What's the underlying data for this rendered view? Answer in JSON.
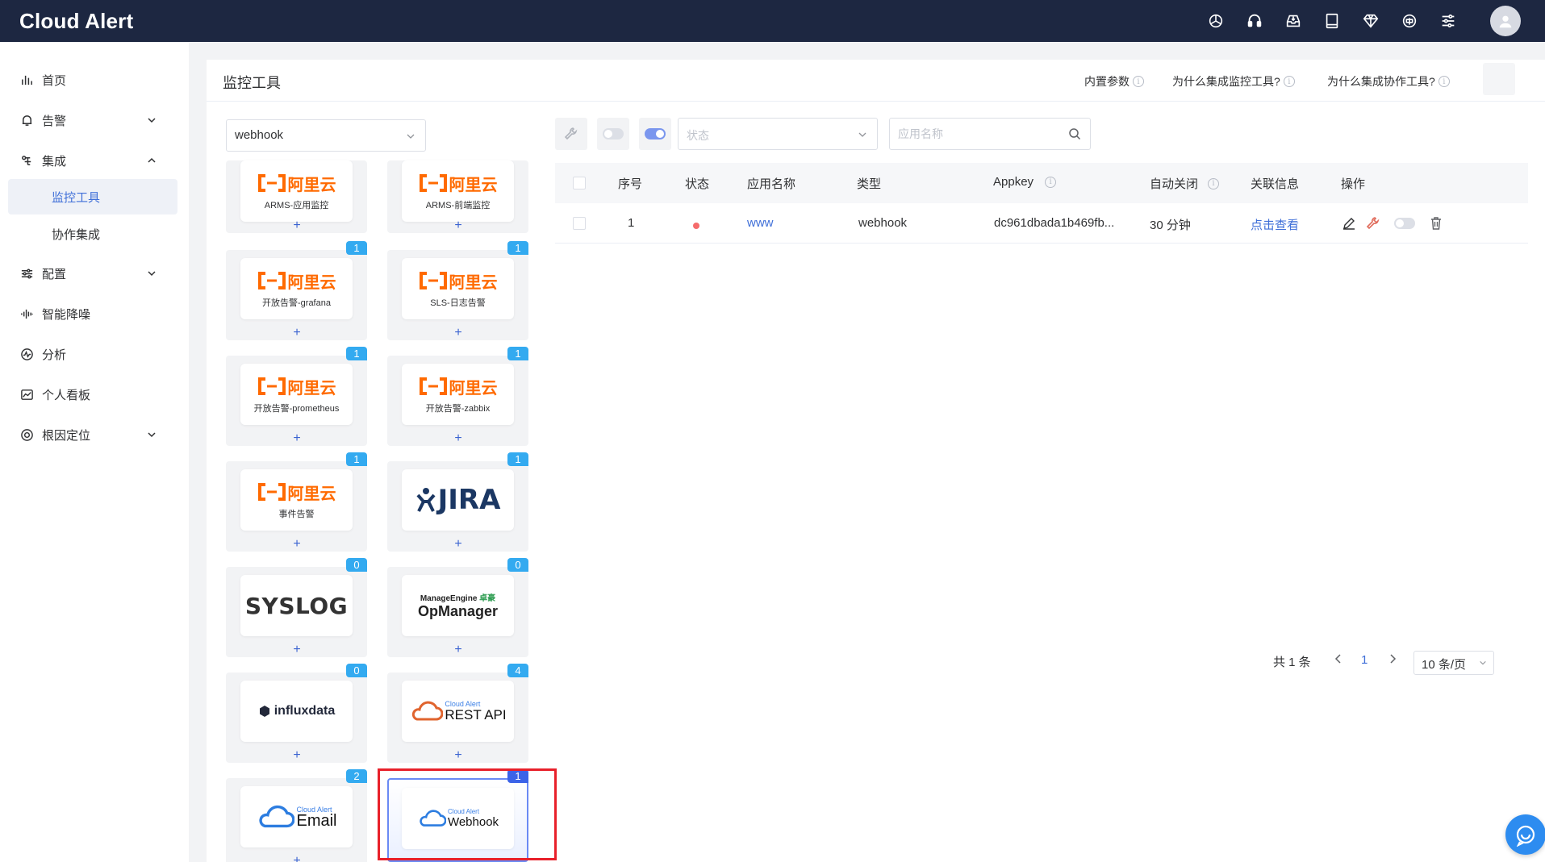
{
  "app": {
    "title": "Cloud Alert"
  },
  "topbar": {
    "icons": [
      "openai-icon",
      "headset-icon",
      "inbox-icon",
      "book-icon",
      "diamond-icon",
      "language-icon",
      "settings-sliders-icon"
    ],
    "avatar": "user-avatar"
  },
  "sidebar": {
    "items": [
      {
        "label": "首页",
        "icon": "bar-chart-icon"
      },
      {
        "label": "告警",
        "icon": "bell-icon",
        "expandable": true,
        "expanded": false
      },
      {
        "label": "集成",
        "icon": "integration-icon",
        "expandable": true,
        "expanded": true
      },
      {
        "label": "配置",
        "icon": "sliders-icon",
        "expandable": true,
        "expanded": false
      },
      {
        "label": "智能降噪",
        "icon": "waveform-icon"
      },
      {
        "label": "分析",
        "icon": "gauge-icon"
      },
      {
        "label": "个人看板",
        "icon": "dashboard-icon"
      },
      {
        "label": "根因定位",
        "icon": "target-icon",
        "expandable": true,
        "expanded": false
      }
    ],
    "subitems": [
      {
        "label": "监控工具",
        "active": true
      },
      {
        "label": "协作集成",
        "active": false
      }
    ]
  },
  "header": {
    "title": "监控工具",
    "links": [
      "内置参数",
      "为什么集成监控工具?",
      "为什么集成协作工具?"
    ]
  },
  "filter": {
    "type_value": "webhook"
  },
  "cards": [
    {
      "kind": "aliyun",
      "brand": "阿里云",
      "name": "ARMS-应用监控",
      "badge": null
    },
    {
      "kind": "aliyun",
      "brand": "阿里云",
      "name": "ARMS-前端监控",
      "badge": null
    },
    {
      "kind": "aliyun",
      "brand": "阿里云",
      "name": "开放告警-grafana",
      "badge": "1"
    },
    {
      "kind": "aliyun",
      "brand": "阿里云",
      "name": "SLS-日志告警",
      "badge": "1"
    },
    {
      "kind": "aliyun",
      "brand": "阿里云",
      "name": "开放告警-prometheus",
      "badge": "1"
    },
    {
      "kind": "aliyun",
      "brand": "阿里云",
      "name": "开放告警-zabbix",
      "badge": "1"
    },
    {
      "kind": "aliyun",
      "brand": "阿里云",
      "name": "事件告警",
      "badge": "1"
    },
    {
      "kind": "jira",
      "brand": "JIRA",
      "name": "",
      "badge": "1"
    },
    {
      "kind": "syslog",
      "brand": "SYSLOG",
      "name": "",
      "badge": "0"
    },
    {
      "kind": "manageengine",
      "brand": "ManageEngine",
      "brand_cn": "卓豪",
      "name": "OpManager",
      "badge": "0"
    },
    {
      "kind": "influx",
      "brand": "influxdata",
      "name": "",
      "badge": "0"
    },
    {
      "kind": "cloudalert",
      "brand": "Cloud Alert",
      "name": "REST API",
      "badge": "4"
    },
    {
      "kind": "cloudalert",
      "brand": "Cloud Alert",
      "name": "Email",
      "badge": "2"
    },
    {
      "kind": "cloudalert",
      "brand": "Cloud Alert",
      "name": "Webhook",
      "badge": "1",
      "selected": true
    }
  ],
  "toolbar": {
    "status_placeholder": "状态",
    "name_placeholder": "应用名称"
  },
  "table": {
    "headers": {
      "index": "序号",
      "status": "状态",
      "app_name": "应用名称",
      "type": "类型",
      "appkey": "Appkey",
      "auto_close": "自动关闭",
      "related": "关联信息",
      "actions": "操作"
    },
    "rows": [
      {
        "index": "1",
        "status": "red",
        "app_name": "www",
        "type": "webhook",
        "appkey": "dc961dbada1b469fb...",
        "auto_close": "30 分钟",
        "related": "点击查看"
      }
    ]
  },
  "pagination": {
    "total": "共 1 条",
    "current": "1",
    "page_size": "10 条/页"
  },
  "colors": {
    "topbar": "#1d2741",
    "accent": "#3f6fd8",
    "aliyun": "#ff6a00",
    "badge": "#33aaf0",
    "highlight": "#e8202a"
  }
}
